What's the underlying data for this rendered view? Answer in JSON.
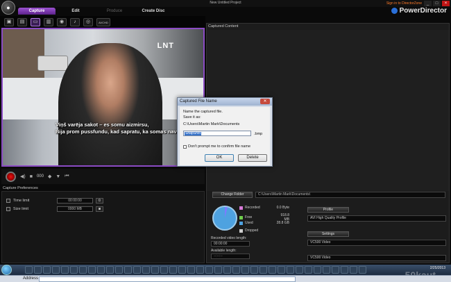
{
  "window": {
    "title": "New Untitled Project",
    "signin": "Sign in to DirectorZone",
    "controls": [
      "_",
      "□",
      "×"
    ]
  },
  "brand": {
    "name": "PowerDirector"
  },
  "modes": [
    {
      "label": "Capture",
      "active": true
    },
    {
      "label": "Edit",
      "active": false
    },
    {
      "label": "Produce",
      "active": false,
      "dim": true
    },
    {
      "label": "Create Disc",
      "active": false
    }
  ],
  "toolbar": {
    "tools": [
      "dv-camcorder-icon",
      "hdv-camcorder-icon",
      "tv-icon",
      "digital-tv-icon",
      "webcam-icon",
      "microphone-icon",
      "cd-icon",
      "avchd-icon"
    ],
    "avchd_label": "AVCHD"
  },
  "video": {
    "channel_logo": "LNT",
    "subtitle_line1": "Viņš varēja sakot – es somu aizmirsu,",
    "subtitle_line2": "Bija prom pussfundu, kad sapratu, ka somas nav"
  },
  "playback": {
    "timecode": "000"
  },
  "capture_preferences": {
    "label": "Capture Preferences",
    "time_limit": {
      "label": "Time limit",
      "value": "00:00:00"
    },
    "size_limit": {
      "label": "Size limit",
      "value": "0000",
      "unit": "MB"
    }
  },
  "captured_content": {
    "label": "Captured Content"
  },
  "change_folder": {
    "label": "Change Folder",
    "path": "C:\\Users\\Martin Mark\\Documents\\"
  },
  "disk": {
    "legend": [
      {
        "label": "Recorded",
        "value": "0.0 Byte",
        "color": "#d97ad9"
      },
      {
        "label": "Free",
        "value": "918.8 MB",
        "color": "#6fcf4c"
      },
      {
        "label": "Used",
        "value": "28.8 GB",
        "color": "#4ea2e0"
      },
      {
        "label": "Dropped",
        "value": "",
        "color": "#cfcfcf"
      }
    ],
    "recorded_length_label": "Recorded video length:",
    "recorded_length_value": "00:00:00",
    "available_length_label": "Available length:",
    "available_length_value": "--:--:--"
  },
  "profile": {
    "button": "Profile",
    "value": "AVI High Quality Profile"
  },
  "settings": {
    "button": "Settings",
    "value1": "VC500 Video",
    "value2": "VC500 Video"
  },
  "dialog": {
    "title": "Captured File Name",
    "line1": "Name the captured file.",
    "line2": "Save it as:",
    "path": "C:\\Users\\Martin Mark\\Documents",
    "filename": "SnapShot",
    "ext": ".bmp",
    "checkbox": "Don't prompt me to confirm file name",
    "ok": "OK",
    "delete": "Delete"
  },
  "taskbar": {
    "date": "2/25/2013",
    "watermark": "50kaut"
  },
  "addressbar": {
    "label": "Address"
  }
}
